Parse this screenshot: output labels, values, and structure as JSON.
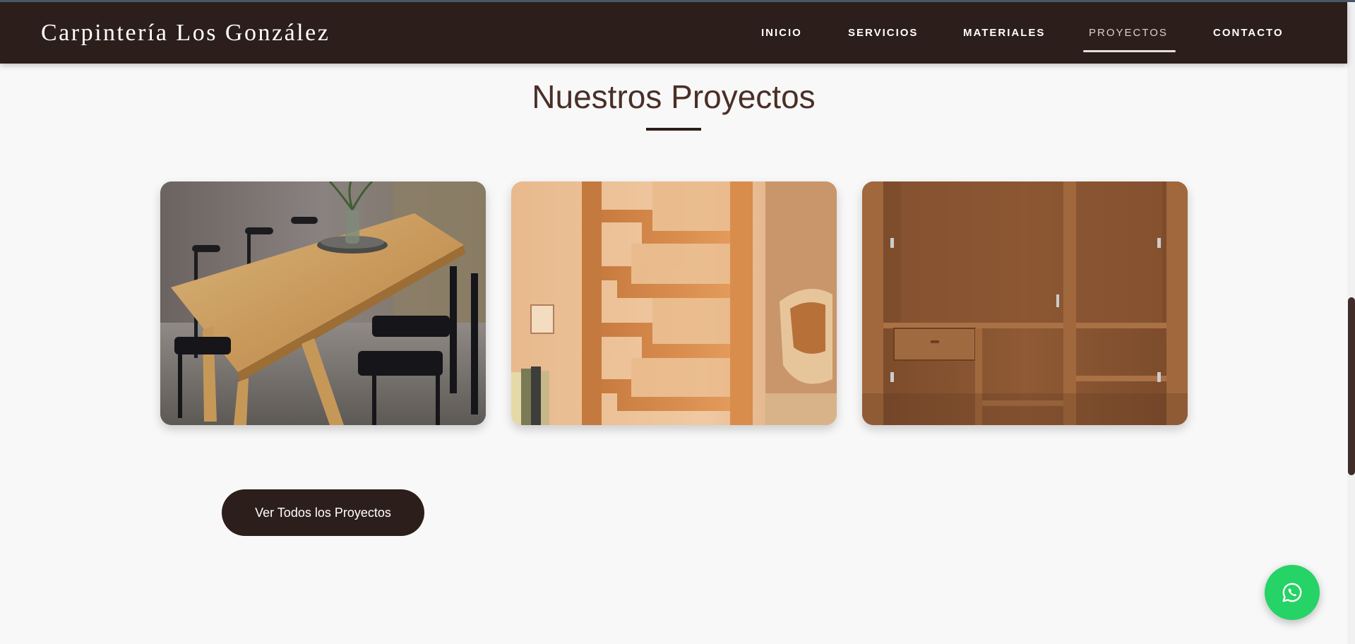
{
  "header": {
    "brand": "Carpintería Los González",
    "nav": [
      {
        "label": "INICIO",
        "active": false
      },
      {
        "label": "SERVICIOS",
        "active": false
      },
      {
        "label": "MATERIALES",
        "active": false
      },
      {
        "label": "PROYECTOS",
        "active": true
      },
      {
        "label": "CONTACTO",
        "active": false
      }
    ]
  },
  "section": {
    "title": "Nuestros Proyectos",
    "projects": [
      {
        "image": "dining-table-photo"
      },
      {
        "image": "corner-shelf-photo"
      },
      {
        "image": "wardrobe-photo"
      }
    ],
    "cta_label": "Ver Todos los Proyectos"
  },
  "floating": {
    "icon": "whatsapp-icon",
    "color": "#25d366"
  },
  "colors": {
    "primary": "#2c1e1a",
    "title": "#4a2f27",
    "background": "#f8f8f8"
  }
}
